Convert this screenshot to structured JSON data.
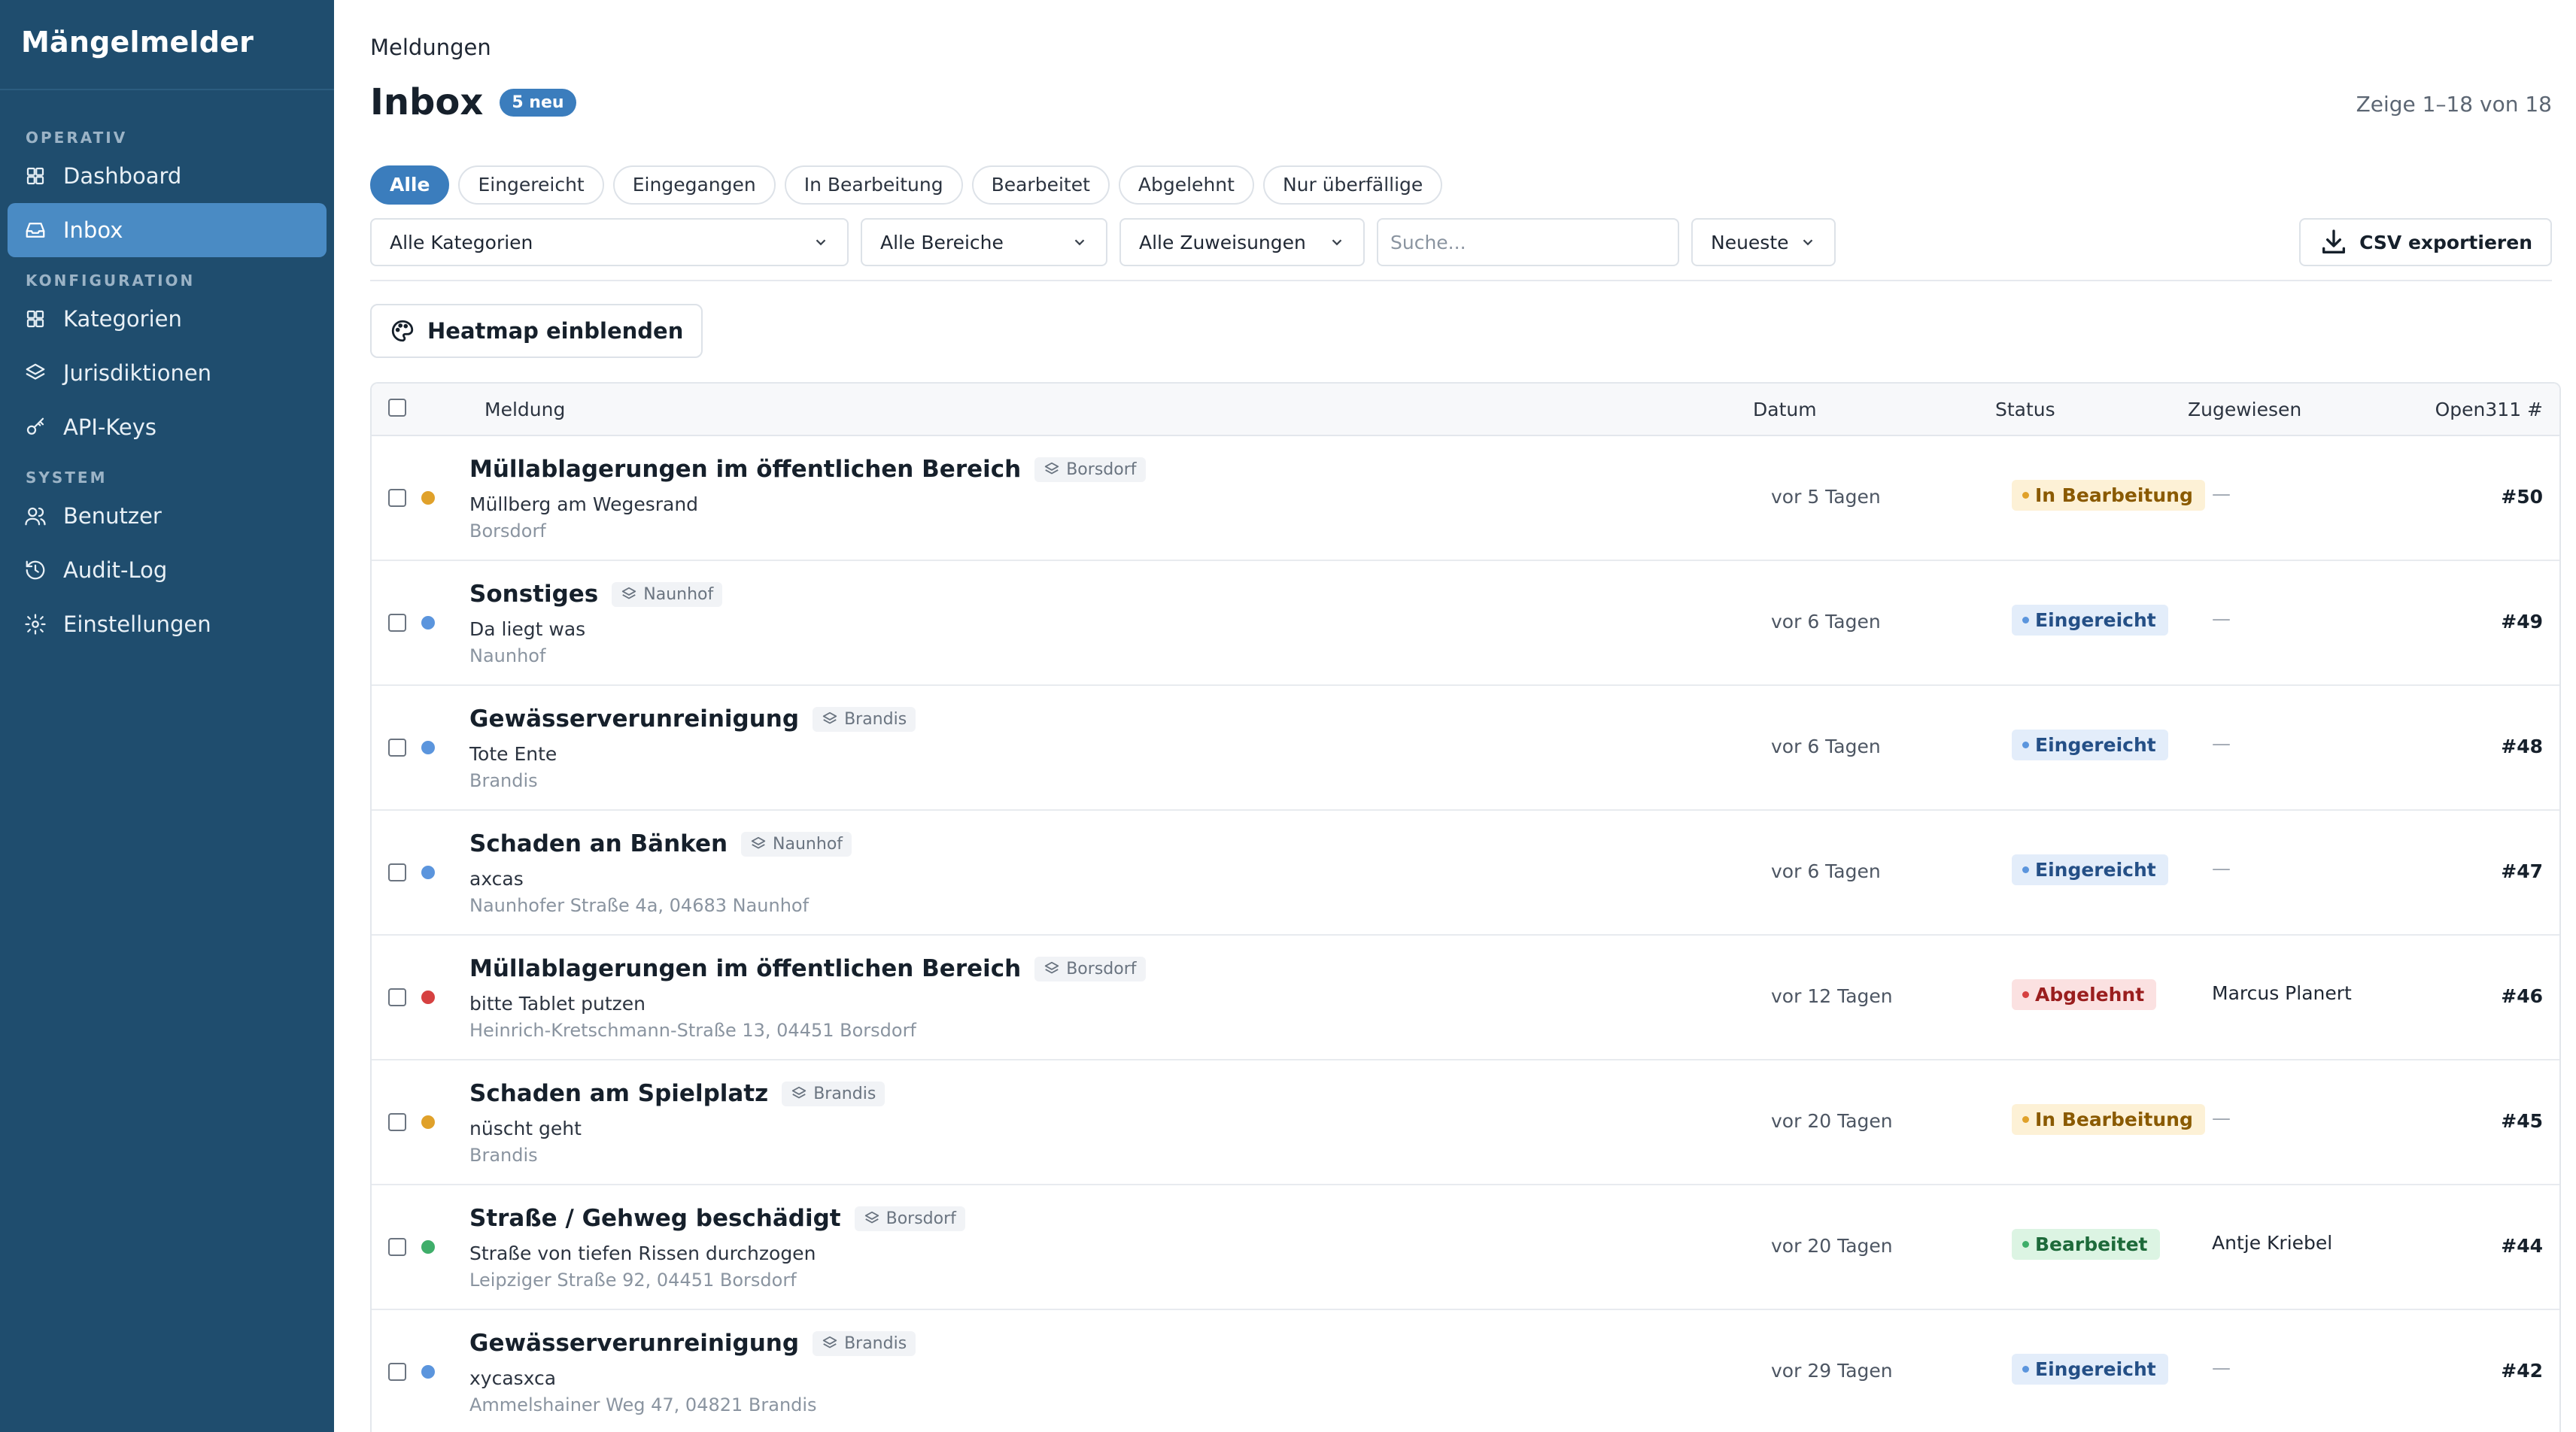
{
  "app": {
    "name": "Mängelmelder"
  },
  "sidebar": {
    "sections": [
      {
        "label": "OPERATIV",
        "items": [
          {
            "label": "Dashboard",
            "icon": "grid-icon",
            "active": false
          },
          {
            "label": "Inbox",
            "icon": "inbox-icon",
            "active": true
          }
        ]
      },
      {
        "label": "KONFIGURATION",
        "items": [
          {
            "label": "Kategorien",
            "icon": "grid-icon",
            "active": false
          },
          {
            "label": "Jurisdiktionen",
            "icon": "layers-icon",
            "active": false
          },
          {
            "label": "API-Keys",
            "icon": "key-icon",
            "active": false
          }
        ]
      },
      {
        "label": "SYSTEM",
        "items": [
          {
            "label": "Benutzer",
            "icon": "users-icon",
            "active": false
          },
          {
            "label": "Audit-Log",
            "icon": "history-icon",
            "active": false
          },
          {
            "label": "Einstellungen",
            "icon": "gear-icon",
            "active": false
          }
        ]
      }
    ]
  },
  "header": {
    "breadcrumb": "Meldungen",
    "title": "Inbox",
    "new_badge": "5 neu",
    "showing": "Zeige 1–18 von 18"
  },
  "tabs": [
    {
      "label": "Alle",
      "active": true
    },
    {
      "label": "Eingereicht",
      "active": false
    },
    {
      "label": "Eingegangen",
      "active": false
    },
    {
      "label": "In Bearbeitung",
      "active": false
    },
    {
      "label": "Bearbeitet",
      "active": false
    },
    {
      "label": "Abgelehnt",
      "active": false
    },
    {
      "label": "Nur überfällige",
      "active": false
    }
  ],
  "filters": {
    "category": "Alle Kategorien",
    "area": "Alle Bereiche",
    "assignment": "Alle Zuweisungen",
    "search_placeholder": "Suche...",
    "sort": "Neueste",
    "csv_label": "CSV exportieren"
  },
  "heatmap_label": "Heatmap einblenden",
  "table": {
    "columns": {
      "message": "Meldung",
      "date": "Datum",
      "status": "Status",
      "assigned": "Zugewiesen",
      "number": "Open311 #"
    },
    "rows": [
      {
        "title": "Müllablagerungen im öffentlichen Bereich",
        "region": "Borsdorf",
        "desc": "Müllberg am Wegesrand",
        "addr": "Borsdorf",
        "date": "vor 5 Tagen",
        "status": "In Bearbeitung",
        "status_kind": "progress",
        "dot_color": "#e0a12a",
        "assigned": "—",
        "number": "#50"
      },
      {
        "title": "Sonstiges",
        "region": "Naunhof",
        "desc": "Da liegt was",
        "addr": "Naunhof",
        "date": "vor 6 Tagen",
        "status": "Eingereicht",
        "status_kind": "sub",
        "dot_color": "#5b95dd",
        "assigned": "—",
        "number": "#49"
      },
      {
        "title": "Gewässerverunreinigung",
        "region": "Brandis",
        "desc": "Tote Ente",
        "addr": "Brandis",
        "date": "vor 6 Tagen",
        "status": "Eingereicht",
        "status_kind": "sub",
        "dot_color": "#5b95dd",
        "assigned": "—",
        "number": "#48"
      },
      {
        "title": "Schaden an Bänken",
        "region": "Naunhof",
        "desc": "axcas",
        "addr": "Naunhofer Straße 4a, 04683 Naunhof",
        "date": "vor 6 Tagen",
        "status": "Eingereicht",
        "status_kind": "sub",
        "dot_color": "#5b95dd",
        "assigned": "—",
        "number": "#47"
      },
      {
        "title": "Müllablagerungen im öffentlichen Bereich",
        "region": "Borsdorf",
        "desc": "bitte Tablet putzen",
        "addr": "Heinrich-Kretschmann-Straße 13, 04451 Borsdorf",
        "date": "vor 12 Tagen",
        "status": "Abgelehnt",
        "status_kind": "rej",
        "dot_color": "#d64141",
        "assigned": "Marcus Planert",
        "number": "#46"
      },
      {
        "title": "Schaden am Spielplatz",
        "region": "Brandis",
        "desc": "nüscht geht",
        "addr": "Brandis",
        "date": "vor 20 Tagen",
        "status": "In Bearbeitung",
        "status_kind": "progress",
        "dot_color": "#e0a12a",
        "assigned": "—",
        "number": "#45"
      },
      {
        "title": "Straße / Gehweg beschädigt",
        "region": "Borsdorf",
        "desc": "Straße von tiefen Rissen durchzogen",
        "addr": "Leipziger Straße 92, 04451 Borsdorf",
        "date": "vor 20 Tagen",
        "status": "Bearbeitet",
        "status_kind": "done",
        "dot_color": "#3fae6a",
        "assigned": "Antje Kriebel",
        "number": "#44"
      },
      {
        "title": "Gewässerverunreinigung",
        "region": "Brandis",
        "desc": "xycasxca",
        "addr": "Ammelshainer Weg 47, 04821 Brandis",
        "date": "vor 29 Tagen",
        "status": "Eingereicht",
        "status_kind": "sub",
        "dot_color": "#5b95dd",
        "assigned": "—",
        "number": "#42"
      }
    ]
  }
}
